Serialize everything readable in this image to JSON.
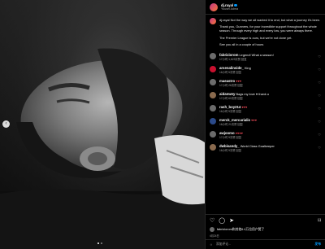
{
  "post": {
    "username": "dj.rayal",
    "subtitle": "Yuusei Adma",
    "caption": [
      "dj.rayal Not the way we all wanted it to end, but what a journey it's been.",
      "Thank you, Gunners, for your incredible support throughout the whole season. Through every high and every low, you were always there.",
      "The Premier League is ours, but we're not done yet.",
      "See you all in a couple of hours"
    ]
  },
  "comments": [
    {
      "user": "fabriziorom",
      "text": "Legend! What a season!",
      "meta": "17小时  1,623次赞  回复",
      "avatar": "gray"
    },
    {
      "user": "arsenalinside_",
      "text": "King",
      "meta": "16小时  5次赞  回复",
      "avatar": "red"
    },
    {
      "user": "maeastro",
      "text": "♥♥♥",
      "meta": "17小时  26次赞  回复",
      "avatar": "gray"
    },
    {
      "user": "aidanwey",
      "text": "Bags my love ♥ thank u",
      "meta": "17小时  60次赞  回复",
      "avatar": "brown"
    },
    {
      "user": "rash_boy214",
      "text": "♥♥♥",
      "meta": "16小时  9次赞  回复",
      "avatar": "gray"
    },
    {
      "user": "merck_mercurialis",
      "text": "♥♥♥",
      "meta": "16小时  21次赞  回复",
      "avatar": "blue"
    },
    {
      "user": "awjoomo",
      "text": "♥♥♥♥",
      "meta": "17小时  9次赞  回复",
      "avatar": "gray"
    },
    {
      "user": "dwbisandy_",
      "text": "World Class Goalkeeper",
      "meta": "16小时  9次赞  回复",
      "avatar": "brown"
    }
  ],
  "actions": {
    "likes_text": "fabriziorom和其他6.4万位用户赞了",
    "date": "4月24日"
  },
  "add_comment": {
    "placeholder": "添加评论...",
    "post_label": "发布"
  },
  "nav": {
    "prev_label": "‹"
  }
}
